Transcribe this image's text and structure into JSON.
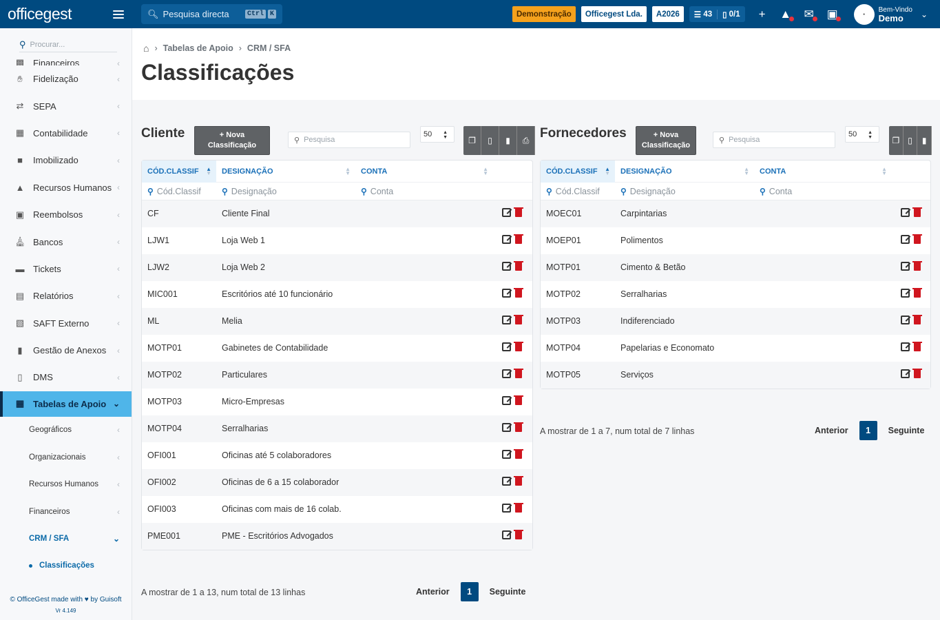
{
  "topbar": {
    "logo": "officegest",
    "search_placeholder": "Pesquisa directa",
    "shortcut_keys": [
      "Ctrl",
      "K"
    ],
    "badge_demo": "Demonstração",
    "badge_company": "Officegest Lda.",
    "badge_year": "A2026",
    "counter_tasks": "43",
    "counter_folders": "0/1",
    "greeting": "Bem-Vindo",
    "user_name": "Demo",
    "accent_color": "#004a80"
  },
  "sidebar": {
    "search_placeholder": "Procurar...",
    "items": [
      {
        "label": "Financeiros",
        "icon": "money-icon"
      },
      {
        "label": "Fidelização",
        "icon": "hand-coin-icon"
      },
      {
        "label": "SEPA",
        "icon": "exchange-icon"
      },
      {
        "label": "Contabilidade",
        "icon": "calculator-icon"
      },
      {
        "label": "Imobilizado",
        "icon": "boxes-icon"
      },
      {
        "label": "Recursos Humanos",
        "icon": "org-chart-icon"
      },
      {
        "label": "Reembolsos",
        "icon": "money-bill-icon"
      },
      {
        "label": "Bancos",
        "icon": "bank-icon"
      },
      {
        "label": "Tickets",
        "icon": "ticket-icon"
      },
      {
        "label": "Relatórios",
        "icon": "chart-icon"
      },
      {
        "label": "SAFT Externo",
        "icon": "saft-icon"
      },
      {
        "label": "Gestão de Anexos",
        "icon": "file-icon"
      },
      {
        "label": "DMS",
        "icon": "folder-icon"
      }
    ],
    "active": "Tabelas de Apoio",
    "submenu": [
      "Geográficos",
      "Organizacionais",
      "Recursos Humanos",
      "Financeiros"
    ],
    "submenu_open": "CRM / SFA",
    "leaf": "Classificações",
    "footer_text": "© OfficeGest made with ♥ by Guisoft",
    "version": "Vr 4.149"
  },
  "page": {
    "breadcrumb": [
      "Tabelas de Apoio",
      "CRM / SFA"
    ],
    "title": "Classificações"
  },
  "cliente": {
    "title": "Cliente",
    "new_button": [
      "+ Nova",
      "Classificação"
    ],
    "search_placeholder": "Pesquisa",
    "page_size": "50",
    "columns": [
      "CÓD.CLASSIF",
      "DESIGNAÇÃO",
      "CONTA"
    ],
    "filters": [
      "Cód.Classif",
      "Designação",
      "Conta"
    ],
    "rows": [
      [
        "CF",
        "Cliente Final"
      ],
      [
        "LJW1",
        "Loja Web 1"
      ],
      [
        "LJW2",
        "Loja Web 2"
      ],
      [
        "MIC001",
        "Escritórios até 10 funcionário"
      ],
      [
        "ML",
        "Melia"
      ],
      [
        "MOTP01",
        "Gabinetes de Contabilidade"
      ],
      [
        "MOTP02",
        "Particulares"
      ],
      [
        "MOTP03",
        "Micro-Empresas"
      ],
      [
        "MOTP04",
        "Serralharias"
      ],
      [
        "OFI001",
        "Oficinas até 5 colaboradores"
      ],
      [
        "OFI002",
        "Oficinas de 6 a 15 colaborador"
      ],
      [
        "OFI003",
        "Oficinas com mais de 16 colab."
      ],
      [
        "PME001",
        "PME - Escritórios Advogados"
      ]
    ],
    "info": "A mostrar de 1 a 13, num total de 13 linhas",
    "prev": "Anterior",
    "current_page": "1",
    "next": "Seguinte"
  },
  "fornecedores": {
    "title": "Fornecedores",
    "new_button": [
      "+ Nova",
      "Classificação"
    ],
    "search_placeholder": "Pesquisa",
    "page_size": "50",
    "columns": [
      "CÓD.CLASSIF",
      "DESIGNAÇÃO",
      "CONTA"
    ],
    "filters": [
      "Cód.Classif",
      "Designação",
      "Conta"
    ],
    "rows": [
      [
        "MOEC01",
        "Carpintarias"
      ],
      [
        "MOEP01",
        "Polimentos"
      ],
      [
        "MOTP01",
        "Cimento & Betão"
      ],
      [
        "MOTP02",
        "Serralharias"
      ],
      [
        "MOTP03",
        "Indiferenciado"
      ],
      [
        "MOTP04",
        "Papelarias e Economato"
      ],
      [
        "MOTP05",
        "Serviços"
      ]
    ],
    "info": "A mostrar de 1 a 7, num total de 7 linhas",
    "prev": "Anterior",
    "current_page": "1",
    "next": "Seguinte"
  }
}
